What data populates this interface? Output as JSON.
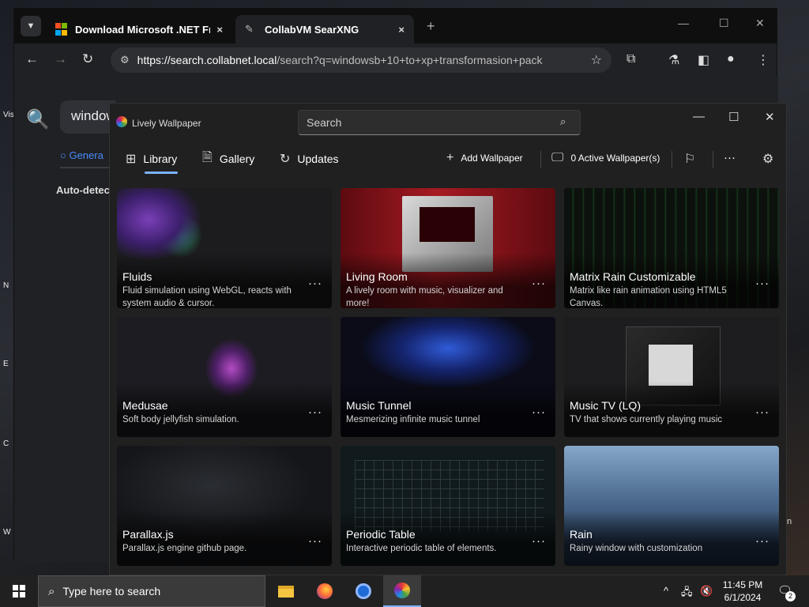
{
  "desktop": {
    "left_icons": [
      "Vis",
      "N",
      "E",
      "C",
      "W"
    ],
    "right_fragment": "n"
  },
  "browser": {
    "tab_menu_icon": "chevron-down-icon",
    "tabs": [
      {
        "title": "Download Microsoft .NET Fran",
        "close": "×",
        "icon": "microsoft-logo-icon"
      },
      {
        "title": "CollabVM SearXNG",
        "close": "×",
        "icon": "searxng-logo-icon"
      }
    ],
    "new_tab": "+",
    "window_controls": {
      "minimize": "—",
      "maximize": "☐",
      "close": "✕"
    },
    "nav": {
      "back": "←",
      "forward": "→",
      "reload": "↻"
    },
    "url_host": "https://search.collabnet.local",
    "url_rest": "/search?q=windowsb+10+to+xp+transformasion+pack",
    "bookmark_icon": "☆",
    "toolbar_icons": {
      "extensions": "⧉",
      "labs": "⚗",
      "sidepanel": "◧",
      "profile": "●",
      "menu": "⋮"
    },
    "page": {
      "search_icon": "🔍",
      "search_value": "window",
      "tab_label": "Genera",
      "auto_detect": "Auto-detect"
    }
  },
  "lively": {
    "app_name": "Lively Wallpaper",
    "search_placeholder": "Search",
    "controls": {
      "minimize": "—",
      "maximize": "☐",
      "close": "✕"
    },
    "nav": [
      {
        "label": "Library",
        "icon": "⊞"
      },
      {
        "label": "Gallery",
        "icon": "🗎"
      },
      {
        "label": "Updates",
        "icon": "↻"
      }
    ],
    "actions": {
      "add_wallpaper": "Add Wallpaper",
      "active_wallpapers": "0 Active Wallpaper(s)",
      "more": "···",
      "settings_icon": "⚙"
    },
    "wallpapers": [
      {
        "title": "Fluids",
        "desc": "Fluid simulation using WebGL, reacts with system audio & cursor."
      },
      {
        "title": "Living Room",
        "desc": "A lively room with music, visualizer and more!"
      },
      {
        "title": "Matrix Rain Customizable",
        "desc": "Matrix like rain animation using HTML5 Canvas."
      },
      {
        "title": "Medusae",
        "desc": "Soft body jellyfish simulation."
      },
      {
        "title": "Music Tunnel",
        "desc": "Mesmerizing infinite music tunnel"
      },
      {
        "title": "Music TV (LQ)",
        "desc": "TV that shows currently playing music"
      },
      {
        "title": "Parallax.js",
        "desc": "Parallax.js engine github page."
      },
      {
        "title": "Periodic Table",
        "desc": "Interactive periodic table of elements."
      },
      {
        "title": "Rain",
        "desc": "Rainy window with customization"
      }
    ],
    "card_more": "···"
  },
  "taskbar": {
    "search_placeholder": "Type here to search",
    "clock_time": "11:45 PM",
    "clock_date": "6/1/2024",
    "notification_count": "2",
    "tray": {
      "chevron": "^",
      "network": "🖧",
      "volume": "🔇"
    }
  }
}
